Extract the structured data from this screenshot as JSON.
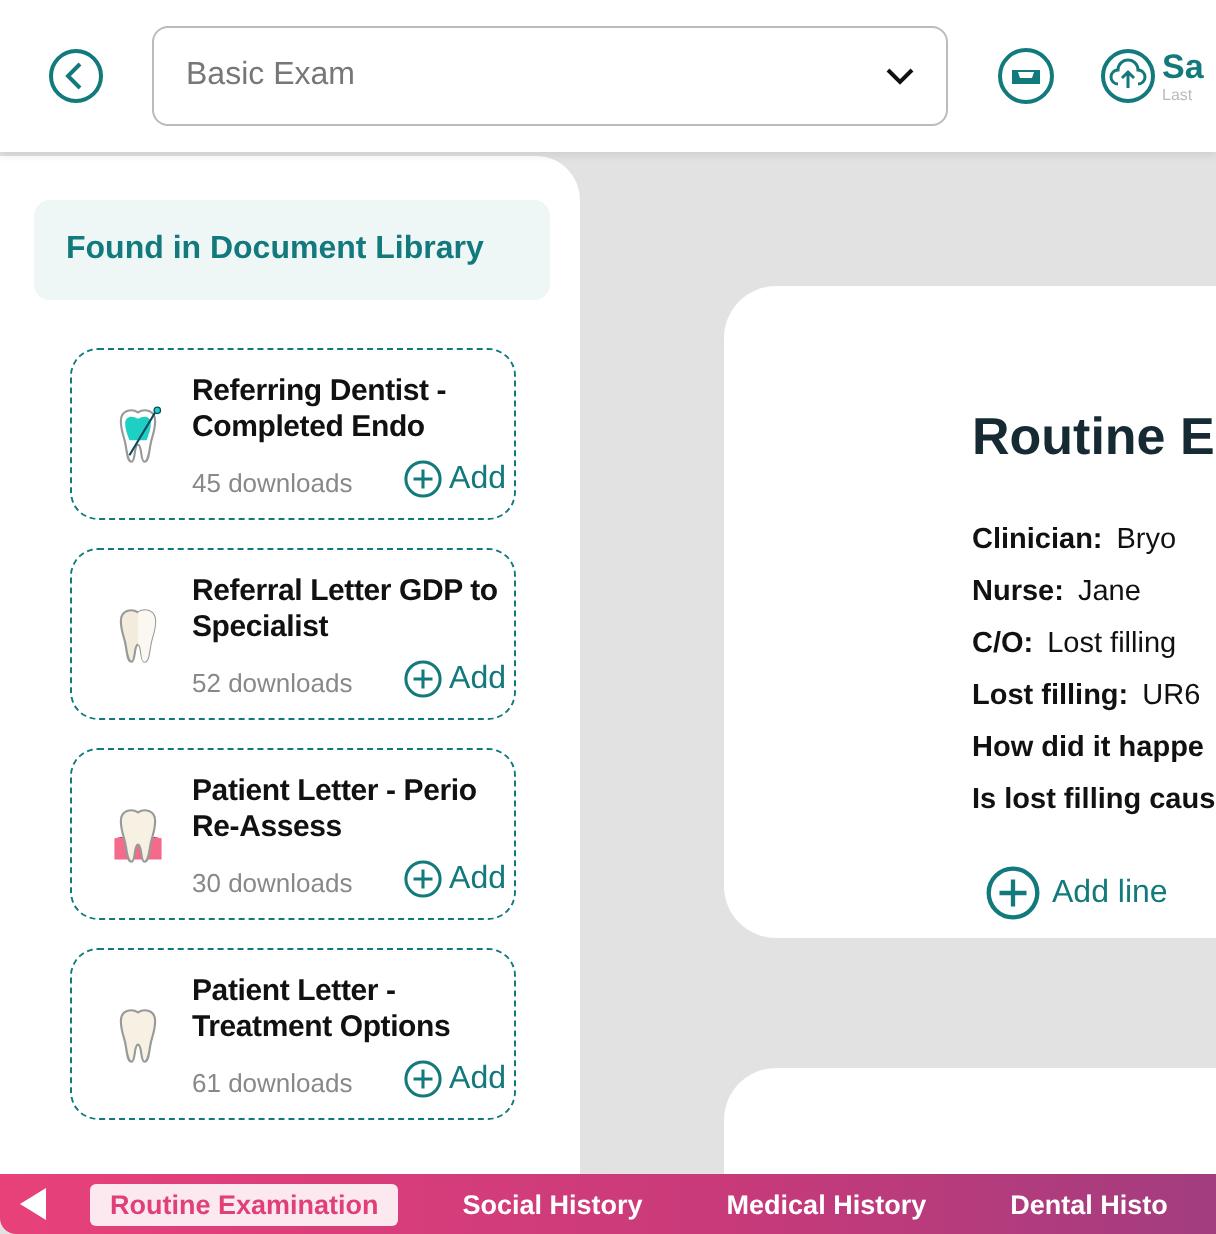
{
  "header": {
    "template": {
      "value": "Basic Exam"
    },
    "save": {
      "label": "Sa",
      "sublabel": "Last"
    }
  },
  "library": {
    "title": "Found in Document Library",
    "documents": [
      {
        "kind": "endo",
        "title": "Referring Dentist - Completed Endo",
        "downloads": "45 downloads",
        "action": "Add"
      },
      {
        "kind": "shaded",
        "title": "Referral Letter GDP to Specialist",
        "downloads": "52 downloads",
        "action": "Add"
      },
      {
        "kind": "perio",
        "title": "Patient Letter - Perio Re-Assess",
        "downloads": "30 downloads",
        "action": "Add"
      },
      {
        "kind": "plain",
        "title": "Patient Letter - Treatment Options",
        "downloads": "61 downloads",
        "action": "Add"
      }
    ]
  },
  "exam": {
    "title": "Routine E",
    "fields": [
      {
        "label": "Clinician:",
        "value": "Bryo"
      },
      {
        "label": "Nurse:",
        "value": "Jane"
      },
      {
        "label": "C/O:",
        "value": "Lost filling"
      },
      {
        "label": "Lost filling:",
        "value": "UR6"
      },
      {
        "label": "How did it happe"
      },
      {
        "label": "Is lost filling caus"
      }
    ],
    "add_line": "Add line"
  },
  "tabs": [
    {
      "label": "Routine Examination",
      "selected": true
    },
    {
      "label": "Social History",
      "selected": false
    },
    {
      "label": "Medical History",
      "selected": false
    },
    {
      "label": "Dental Histo",
      "selected": false
    }
  ]
}
